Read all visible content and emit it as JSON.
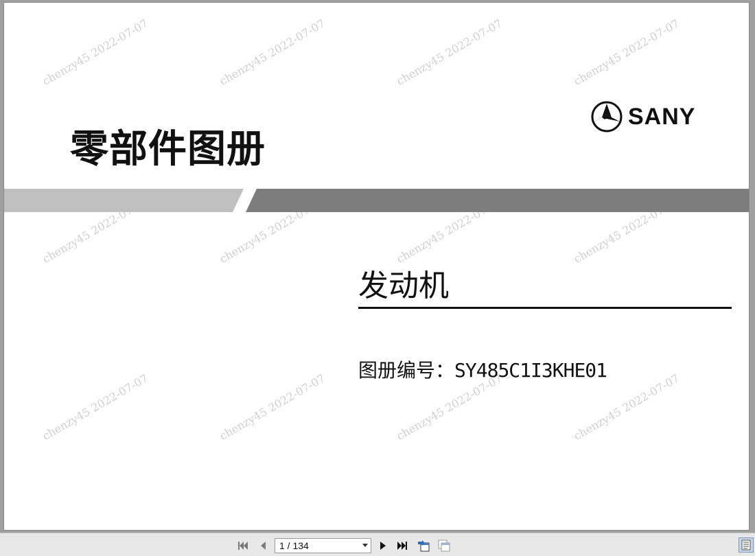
{
  "document": {
    "title": "零部件图册",
    "brand": "SANY",
    "subtitle": "发动机",
    "catalog_label": "图册编号：",
    "catalog_number": "SY485C1I3KHE01",
    "watermark": "chenzy45 2022-07-07"
  },
  "toolbar": {
    "page_indicator": "1 / 134",
    "icons": [
      "first-page-icon",
      "previous-page-icon",
      "next-page-icon",
      "last-page-icon",
      "go-back-icon",
      "go-forward-icon",
      "page-view-icon"
    ]
  },
  "colors": {
    "band_light": "#c0c0c0",
    "band_dark": "#7d7d7d",
    "text": "#111111",
    "viewer_bg": "#a0a0a0"
  }
}
